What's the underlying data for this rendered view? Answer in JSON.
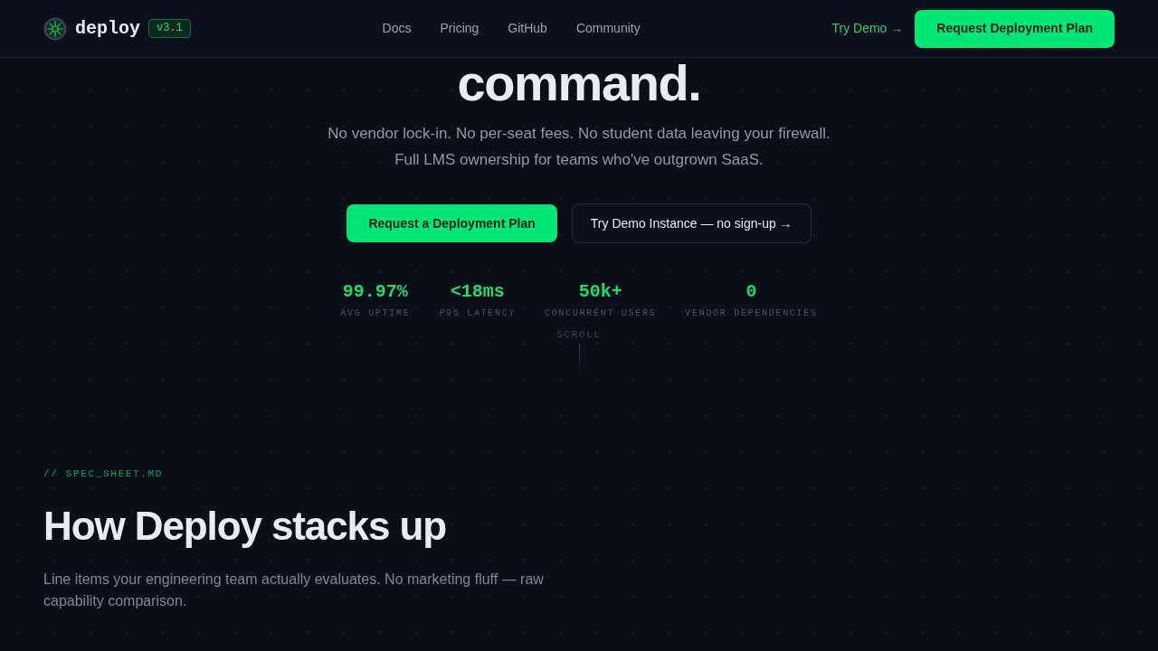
{
  "header": {
    "brand": "deploy",
    "version_badge": "v3.1",
    "nav_links": [
      "Docs",
      "Pricing",
      "GitHub",
      "Community"
    ],
    "demo_link": "Try Demo →",
    "cta_button": "Request Deployment Plan"
  },
  "hero": {
    "heading": "command.",
    "subtitle_lines": [
      "No vendor lock-in. No per-seat fees. No student data leaving your firewall.",
      "Full LMS ownership for teams who've outgrown SaaS."
    ],
    "buttons": [
      {
        "kind": "primary",
        "label": "Request a Deployment Plan"
      },
      {
        "kind": "secondary",
        "label": "Try Demo Instance — no sign-up →"
      }
    ],
    "stats": [
      {
        "value": "99.97%",
        "label": "AVG UPTIME"
      },
      {
        "value": "<18ms",
        "label": "P95 LATENCY"
      },
      {
        "value": "50k+",
        "label": "CONCURRENT USERS"
      },
      {
        "value": "0",
        "label": "VENDOR DEPENDENCIES"
      }
    ],
    "scroll_hint": "SCROLL"
  },
  "spec_section": {
    "eyebrow": "// SPEC_SHEET.MD",
    "heading": "How Deploy stacks up",
    "description": "Line items your engineering team actually evaluates. No marketing fluff — raw capability comparison."
  }
}
